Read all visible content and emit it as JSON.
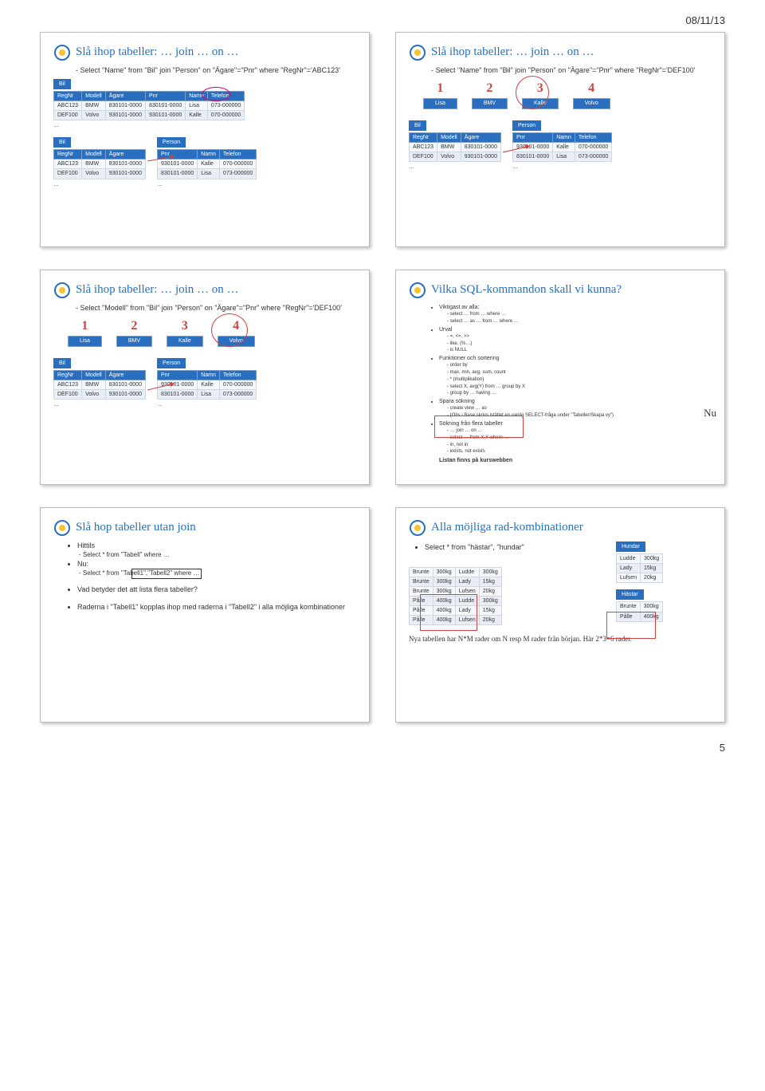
{
  "meta": {
    "date": "08/11/13",
    "pagenum": "5"
  },
  "slide1": {
    "title": "Slå ihop tabeller: … join … on …",
    "sub": "- Select \"Name\" from \"Bil\" join \"Person\" on \"Ägare\"=\"Pnr\" where \"RegNr\"='ABC123'",
    "bilCap": "Bil",
    "bilHead": [
      "RegNr",
      "Modell",
      "Ägare",
      "Pnr",
      "Namn",
      "Telefon"
    ],
    "bilRows": [
      [
        "ABC123",
        "BMW",
        "830101-0000",
        "830101-0000",
        "Lisa",
        "073-000000"
      ],
      [
        "DEF100",
        "Volvo",
        "930101-0000",
        "930101-0000",
        "Kalle",
        "070-000000"
      ]
    ],
    "bil2Cap": "Bil",
    "bil2Head": [
      "RegNr",
      "Modell",
      "Ägare"
    ],
    "bil2Rows": [
      [
        "ABC123",
        "BMW",
        "830101-0000"
      ],
      [
        "DEF100",
        "Volvo",
        "930101-0000"
      ]
    ],
    "personCap": "Person",
    "personHead": [
      "Pnr",
      "Namn",
      "Telefon"
    ],
    "personRows": [
      [
        "930101-0000",
        "Kalle",
        "070-000000"
      ],
      [
        "830101-0000",
        "Lisa",
        "073-000000"
      ]
    ]
  },
  "slide2": {
    "title": "Slå ihop tabeller: … join … on …",
    "sub": "- Select \"Name\" from \"Bil\" join \"Person\" on \"Ägare\"=\"Pnr\" where \"RegNr\"='DEF100'",
    "nums": [
      "1",
      "2",
      "3",
      "4"
    ],
    "vals": [
      "Lisa",
      "BMV",
      "Kalle",
      "Volvo"
    ],
    "bil2Cap": "Bil",
    "bil2Head": [
      "RegNr",
      "Modell",
      "Ägare"
    ],
    "bil2Rows": [
      [
        "ABC123",
        "BMW",
        "830101-0000"
      ],
      [
        "DEF100",
        "Volvo",
        "930101-0000"
      ]
    ],
    "personCap": "Person",
    "personHead": [
      "Pnr",
      "Namn",
      "Telefon"
    ],
    "personRows": [
      [
        "930101-0000",
        "Kalle",
        "070-000000"
      ],
      [
        "830101-0000",
        "Lisa",
        "073-000000"
      ]
    ]
  },
  "slide3": {
    "title": "Slå ihop tabeller: … join … on …",
    "sub": "- Select \"Modell\" from \"Bil\" join \"Person\" on \"Ägare\"=\"Pnr\" where \"RegNr\"='DEF100'",
    "nums": [
      "1",
      "2",
      "3",
      "4"
    ],
    "vals": [
      "Lisa",
      "BMV",
      "Kalle",
      "Volvo"
    ],
    "bil2Cap": "Bil",
    "bil2Head": [
      "RegNr",
      "Modell",
      "Ägare"
    ],
    "bil2Rows": [
      [
        "ABC123",
        "BMW",
        "830101-0000"
      ],
      [
        "DEF100",
        "Volvo",
        "930101-0000"
      ]
    ],
    "personCap": "Person",
    "personHead": [
      "Pnr",
      "Namn",
      "Telefon"
    ],
    "personRows": [
      [
        "930101-0000",
        "Kalle",
        "070-000000"
      ],
      [
        "830101-0000",
        "Lisa",
        "073-000000"
      ]
    ]
  },
  "slide4": {
    "title": "Vilka SQL-kommandon skall vi kunna?",
    "items": [
      {
        "t": "Viktigast av alla:",
        "s": [
          "select … from … where …",
          "select … as … from … where …"
        ]
      },
      {
        "t": "Urval",
        "s": [
          "=, <=, >>",
          "like, (%…)",
          "is NULL"
        ]
      },
      {
        "t": "Funktioner och sortering",
        "s": [
          "order by",
          "max, min, avg, sum, count",
          "* (multiplikation)",
          "select X, avg(Y) from … group by X",
          "group by … having …"
        ]
      },
      {
        "t": "Spara sökning",
        "s": [
          "create view … as",
          "(Obs i Base skrivs istället en vanlig SELECT-fråga under \"Tabeller/Skapa vy\")"
        ]
      },
      {
        "t": "Sökning från flera tabeller",
        "s": [
          "… join … on …",
          "select … from X,Y where …",
          "in, not in",
          "exists, not exists"
        ]
      }
    ],
    "listan": "Listan finns på kurswebben",
    "nu": "Nu"
  },
  "slide5": {
    "title": "Slå hop tabeller utan join",
    "b1": "Hittils",
    "b1s": "- Select * from \"Tabell\" where …",
    "b2": "Nu:",
    "b2s": "- Select * from \"Tabell1\",\"Tabell2\" where …",
    "q": "Vad betyder det att lista flera tabeller?",
    "ans": "Raderna i \"Tabell1\" kopplas ihop med raderna i \"Tabell2\" i alla möjliga kombinationer"
  },
  "slide6": {
    "title": "Alla möjliga rad-kombinationer",
    "sel": "Select * from \"hästar\", \"hundar\"",
    "hundCap": "Hundar",
    "hund": [
      [
        "Ludde",
        "300kg"
      ],
      [
        "Lady",
        "15kg"
      ],
      [
        "Lufsen",
        "20kg"
      ]
    ],
    "hastCap": "Hästar",
    "hast": [
      [
        "Brunte",
        "300kg"
      ],
      [
        "Pålle",
        "400kg"
      ]
    ],
    "join": [
      [
        "Brunte",
        "300kg",
        "Ludde",
        "300kg"
      ],
      [
        "Brunte",
        "300kg",
        "Lady",
        "15kg"
      ],
      [
        "Brunte",
        "300kg",
        "Lufsen",
        "20kg"
      ],
      [
        "Pålle",
        "400kg",
        "Ludde",
        "300kg"
      ],
      [
        "Pålle",
        "400kg",
        "Lady",
        "15kg"
      ],
      [
        "Pålle",
        "400kg",
        "Lufsen",
        "20kg"
      ]
    ],
    "cap": "Nya tabellen har N*M rader om N resp M rader från början. Här 2*3=6 rader."
  }
}
